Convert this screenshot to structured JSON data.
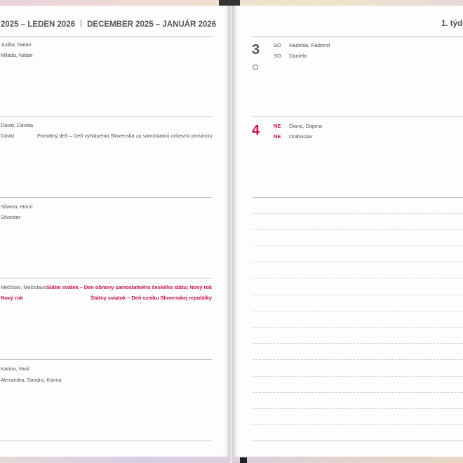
{
  "left_page": {
    "header_cz": "2025 – LEDEN 2026",
    "header_sk": "DECEMBER 2025 – JANUÁR 2026",
    "days": [
      {
        "names_cz": "Judita, Natan",
        "names_sk": "Milada, Nátan",
        "note_sk": ""
      },
      {
        "names_cz": "David, Davida",
        "names_sk": "Dávid",
        "note_sk": "Pamätný deň – Deň vyhlásenia Slovenska za samostatnú cirkevnú provinciu"
      },
      {
        "names_cz": "Silvestr, Horst",
        "names_sk": "Silvester",
        "note_sk": ""
      },
      {
        "names_cz": "Mečislav, Mečislava",
        "names_sk": "Nový rok",
        "holiday_cz": "Státní svátek – Den obnovy samostatného českého státu; Nový rok",
        "holiday_sk": "Štátny sviatok – Deň vzniku Slovenskej republiky"
      },
      {
        "names_cz": "Karina, Vasil",
        "names_sk": "Alexandra, Sandra, Karina",
        "note_sk": ""
      }
    ]
  },
  "right_page": {
    "header": "1. týde",
    "days": [
      {
        "number": "3",
        "abbr_cz": "SO",
        "abbr_sk": "SO",
        "names_cz": "Radmila, Radomil",
        "names_sk": "Daniela"
      },
      {
        "number": "4",
        "abbr_cz": "NE",
        "abbr_sk": "NE",
        "names_cz": "Diana, Dajana",
        "names_sk": "Drahoslav"
      }
    ]
  },
  "colors": {
    "holiday_red": "#c8124b",
    "text_gray": "#555555",
    "rule_gray": "#c4c4c4"
  },
  "icons": {
    "moon_phase": "first-quarter-moon-icon"
  }
}
